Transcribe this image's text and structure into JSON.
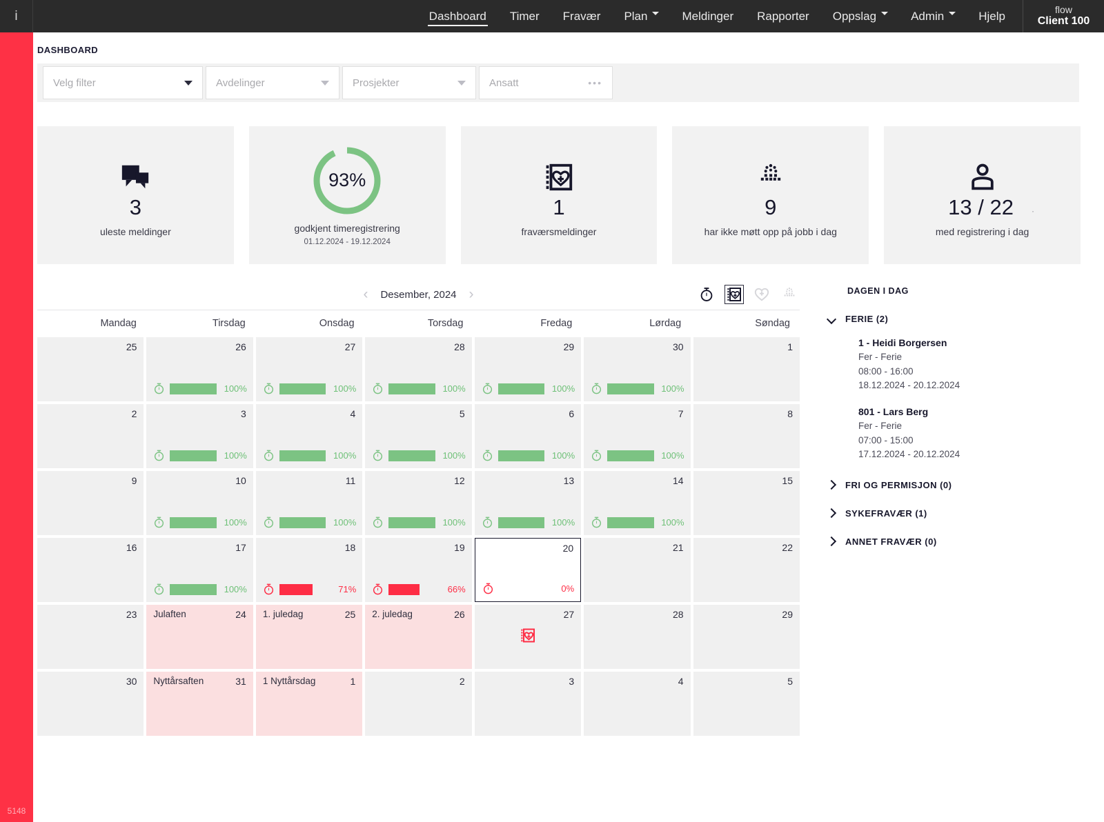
{
  "topbar": {
    "logo": "i",
    "nav": [
      {
        "label": "Dashboard",
        "active": true,
        "caret": false
      },
      {
        "label": "Timer",
        "active": false,
        "caret": false
      },
      {
        "label": "Fravær",
        "active": false,
        "caret": false
      },
      {
        "label": "Plan",
        "active": false,
        "caret": true
      },
      {
        "label": "Meldinger",
        "active": false,
        "caret": false
      },
      {
        "label": "Rapporter",
        "active": false,
        "caret": false
      },
      {
        "label": "Oppslag",
        "active": false,
        "caret": true
      },
      {
        "label": "Admin",
        "active": false,
        "caret": true
      },
      {
        "label": "Hjelp",
        "active": false,
        "caret": false
      }
    ],
    "brand_top": "flow",
    "brand_bottom": "Client 100"
  },
  "rail": {
    "number": "5148",
    "color": "#fe3145"
  },
  "page_title": "DASHBOARD",
  "filters": [
    {
      "placeholder": "Velg filter",
      "control": "chevron-down-icon"
    },
    {
      "placeholder": "Avdelinger",
      "control": "chevron-down-icon"
    },
    {
      "placeholder": "Prosjekter",
      "control": "chevron-down-icon"
    },
    {
      "placeholder": "Ansatt",
      "control": "ellipsis-icon"
    }
  ],
  "cards": [
    {
      "icon": "chat-bubbles-icon",
      "value": "3",
      "caption": "uleste meldinger",
      "sub": ""
    },
    {
      "icon": "donut-chart",
      "value": "93%",
      "caption": "godkjent timeregistrering",
      "sub": "01.12.2024 - 19.12.2024",
      "percent": 93,
      "ring_color": "#7cc383"
    },
    {
      "icon": "absence-card-icon",
      "value": "1",
      "caption": "fraværsmeldinger",
      "sub": ""
    },
    {
      "icon": "dotted-person-icon",
      "value": "9",
      "caption": "har ikke møtt opp på jobb i dag",
      "sub": ""
    },
    {
      "icon": "person-icon",
      "value": "13 / 22",
      "caption": "med registrering i dag",
      "sub": ""
    }
  ],
  "calendar": {
    "month": "Desember, 2024",
    "prev": "‹",
    "next": "›",
    "tools": [
      {
        "name": "stopwatch-icon",
        "selected": false,
        "dim": false
      },
      {
        "name": "absence-card-icon",
        "selected": true,
        "dim": false
      },
      {
        "name": "heart-plus-icon",
        "selected": false,
        "dim": true
      },
      {
        "name": "dotted-person-icon",
        "selected": false,
        "dim": true
      }
    ],
    "weekdays": [
      "Mandag",
      "Tirsdag",
      "Onsdag",
      "Torsdag",
      "Fredag",
      "Lørdag",
      "Søndag"
    ],
    "weeks": [
      [
        {
          "num": "25"
        },
        {
          "num": "26",
          "pct": 100,
          "status": "green"
        },
        {
          "num": "27",
          "pct": 100,
          "status": "green"
        },
        {
          "num": "28",
          "pct": 100,
          "status": "green"
        },
        {
          "num": "29",
          "pct": 100,
          "status": "green"
        },
        {
          "num": "30",
          "pct": 100,
          "status": "green"
        },
        {
          "num": "1"
        }
      ],
      [
        {
          "num": "2"
        },
        {
          "num": "3",
          "pct": 100,
          "status": "green"
        },
        {
          "num": "4",
          "pct": 100,
          "status": "green"
        },
        {
          "num": "5",
          "pct": 100,
          "status": "green"
        },
        {
          "num": "6",
          "pct": 100,
          "status": "green"
        },
        {
          "num": "7",
          "pct": 100,
          "status": "green"
        },
        {
          "num": "8"
        }
      ],
      [
        {
          "num": "9"
        },
        {
          "num": "10",
          "pct": 100,
          "status": "green"
        },
        {
          "num": "11",
          "pct": 100,
          "status": "green"
        },
        {
          "num": "12",
          "pct": 100,
          "status": "green"
        },
        {
          "num": "13",
          "pct": 100,
          "status": "green"
        },
        {
          "num": "14",
          "pct": 100,
          "status": "green"
        },
        {
          "num": "15"
        }
      ],
      [
        {
          "num": "16"
        },
        {
          "num": "17",
          "pct": 100,
          "status": "green"
        },
        {
          "num": "18",
          "pct": 71,
          "status": "red"
        },
        {
          "num": "19",
          "pct": 66,
          "status": "red"
        },
        {
          "num": "20",
          "pct": 0,
          "status": "red",
          "today": true
        },
        {
          "num": "21"
        },
        {
          "num": "22"
        }
      ],
      [
        {
          "num": "23"
        },
        {
          "num": "24",
          "holiday": "Julaften"
        },
        {
          "num": "25",
          "holiday": "1. juledag"
        },
        {
          "num": "26",
          "holiday": "2. juledag"
        },
        {
          "num": "27",
          "marker": "absence-card-icon"
        },
        {
          "num": "28"
        },
        {
          "num": "29"
        }
      ],
      [
        {
          "num": "30"
        },
        {
          "num": "31",
          "holiday": "Nyttårsaften"
        },
        {
          "num": "1",
          "holiday": "1 Nyttårsdag"
        },
        {
          "num": "2"
        },
        {
          "num": "3"
        },
        {
          "num": "4"
        },
        {
          "num": "5"
        }
      ]
    ]
  },
  "today_panel": {
    "title": "DAGEN I DAG",
    "sections": [
      {
        "label": "FERIE (2)",
        "expanded": true,
        "entries": [
          {
            "name": "1 - Heidi Borgersen",
            "type": "Fer - Ferie",
            "time": "08:00 - 16:00",
            "dates": "18.12.2024 - 20.12.2024"
          },
          {
            "name": "801 - Lars Berg",
            "type": "Fer - Ferie",
            "time": "07:00 - 15:00",
            "dates": "17.12.2024 - 20.12.2024"
          }
        ]
      },
      {
        "label": "FRI OG PERMISJON (0)",
        "expanded": false,
        "entries": []
      },
      {
        "label": "SYKEFRAVÆR (1)",
        "expanded": false,
        "entries": []
      },
      {
        "label": "ANNET FRAVÆR (0)",
        "expanded": false,
        "entries": []
      }
    ]
  },
  "colors": {
    "accent_red": "#fe3145",
    "green": "#7cc383",
    "bar_green": "#7cc383",
    "bar_red": "#fe2d45",
    "holiday_bg": "#fbdfe0",
    "header_bg": "#2b2b2b"
  }
}
